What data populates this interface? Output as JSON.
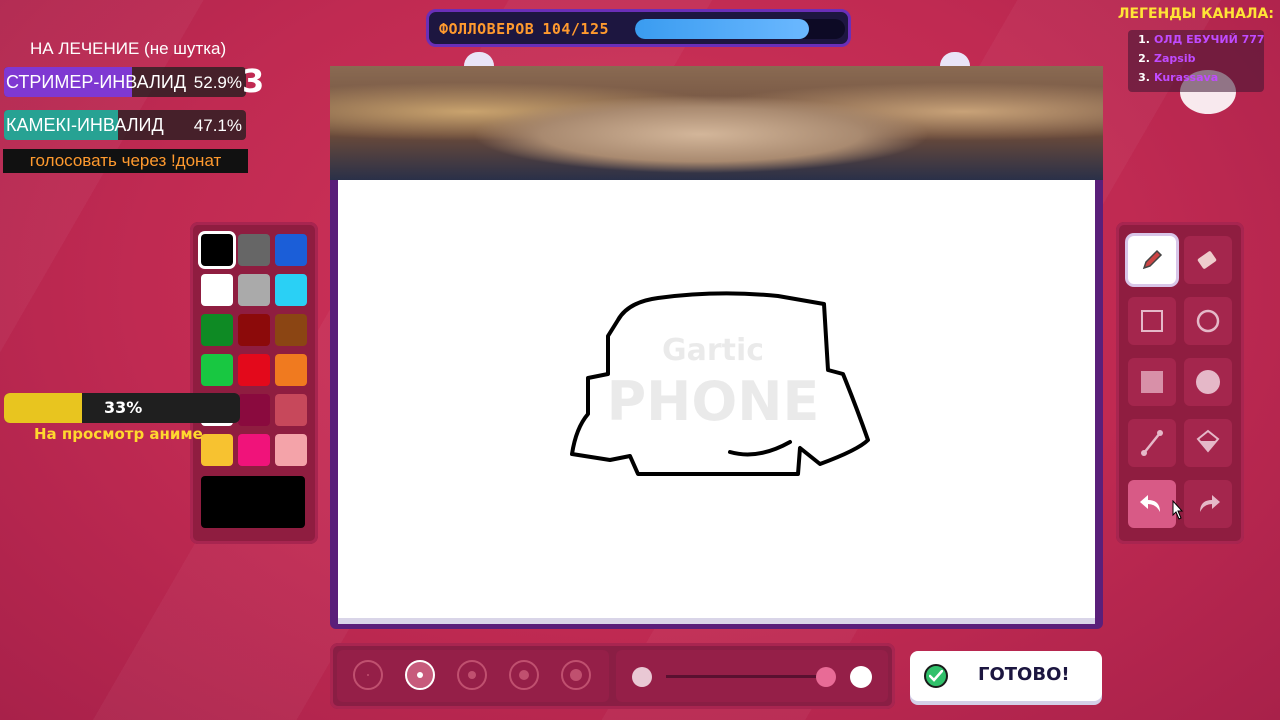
{
  "followers": {
    "label": "ФОЛЛОВЕРОВ",
    "count": "104/125",
    "progress_fraction": 0.83
  },
  "legends": {
    "title": "ЛЕГЕНДЫ КАНАЛА:",
    "items": [
      {
        "rank": "1.",
        "name": "ОЛД ЕБУЧИЙ 777"
      },
      {
        "rank": "2.",
        "name": "Zapsib"
      },
      {
        "rank": "3.",
        "name": "Kurassava"
      }
    ]
  },
  "poll": {
    "title": "НА ЛЕЧЕНИЕ (не шутка)",
    "options": [
      {
        "name": "СТРИМЕР-ИНВАЛИД",
        "percent": "52.9%",
        "fraction": 0.529,
        "color": "#8a3cf0"
      },
      {
        "name": "КАМЕКI-ИНВАЛИД",
        "percent": "47.1%",
        "fraction": 0.471,
        "color": "#22b9a6"
      }
    ],
    "badge": "3",
    "vote_note": "голосовать через !донат"
  },
  "anime": {
    "percent": "33%",
    "fraction": 0.33,
    "label": "На просмотр аниме"
  },
  "palette": {
    "colors": [
      "#000000",
      "#666666",
      "#1b5ed8",
      "#ffffff",
      "#aaaaaa",
      "#2ad0f5",
      "#0e8a24",
      "#8c0a0a",
      "#8b4513",
      "#18c741",
      "#e3091b",
      "#f07a1f",
      "#ffffff",
      "#8a0a3e",
      "#c7485b",
      "#f7c230",
      "#f0137a",
      "#f4a3a9"
    ],
    "selected_index": 0,
    "current_color": "#000000"
  },
  "canvas": {
    "watermark_line1": "Gartic",
    "watermark_line2": "PHONE"
  },
  "tools": [
    {
      "name": "pencil-tool-button",
      "icon": "pencil-icon"
    },
    {
      "name": "eraser-tool-button",
      "icon": "eraser-icon"
    },
    {
      "name": "rectangle-tool-button",
      "icon": "square-outline-icon"
    },
    {
      "name": "ellipse-tool-button",
      "icon": "circle-outline-icon"
    },
    {
      "name": "filled-rectangle-tool-button",
      "icon": "square-filled-icon"
    },
    {
      "name": "filled-ellipse-tool-button",
      "icon": "circle-filled-icon"
    },
    {
      "name": "line-tool-button",
      "icon": "line-icon"
    },
    {
      "name": "fill-bucket-tool-button",
      "icon": "bucket-icon"
    },
    {
      "name": "undo-button",
      "icon": "undo-icon"
    },
    {
      "name": "redo-button",
      "icon": "redo-icon"
    }
  ],
  "brush_sizes_selected": 1,
  "opacity": {
    "value_fraction": 1.0
  },
  "done_button": {
    "label": "ГОТОВО!"
  }
}
